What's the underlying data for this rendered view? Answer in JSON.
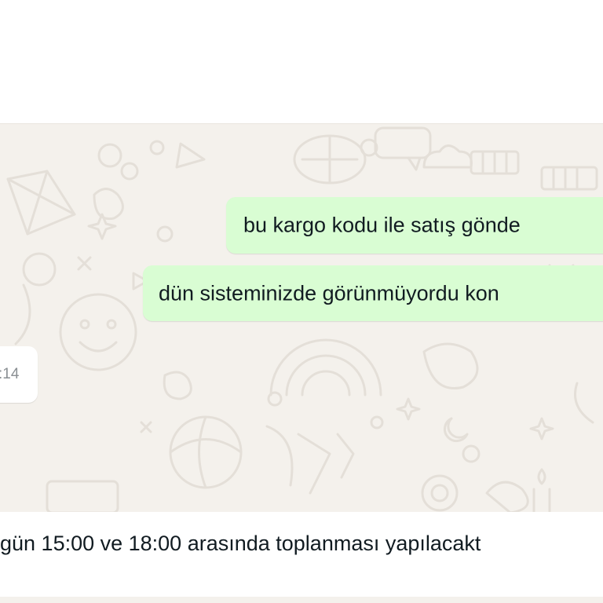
{
  "messages": [
    {
      "direction": "outgoing",
      "text": "bu kargo kodu ile satış gönde"
    },
    {
      "direction": "outgoing",
      "text": "dün sisteminizde görünmüyordu kon"
    },
    {
      "direction": "incoming",
      "time": ":14"
    }
  ],
  "footer_message": {
    "text": "gün 15:00 ve 18:00 arasında toplanması yapılacakt"
  },
  "colors": {
    "chat_background": "#f4f1ec",
    "outgoing_bubble": "#d9fdd3",
    "incoming_bubble": "#ffffff",
    "doodle_stroke": "#e4dfd8",
    "text": "#111b21",
    "timestamp": "#8a8f93"
  },
  "icons": [
    "chat-wallpaper-doodle-icon"
  ]
}
